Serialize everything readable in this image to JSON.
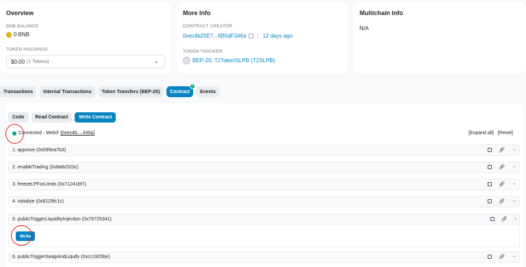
{
  "overview": {
    "title": "Overview",
    "balance_label": "BNB BALANCE",
    "balance_value": "0 BNB",
    "holdings_label": "TOKEN HOLDINGS",
    "holdings_value": "$0.00",
    "holdings_count": "(1 Tokens)"
  },
  "more_info": {
    "title": "More Info",
    "creator_label": "CONTRACT CREATOR",
    "creator_address": "0xec4b25E7...6B5dF346a",
    "creator_age": "12 days ago",
    "tracker_label": "TOKEN TRACKER",
    "tracker_value": "BEP-20: T2TokenSLPB (T2SLPB)"
  },
  "multichain": {
    "title": "Multichain Info",
    "value": "N/A"
  },
  "tabs": [
    "Transactions",
    "Internal Transactions",
    "Token Transfers (BEP-20)",
    "Contract",
    "Events"
  ],
  "active_tab": "Contract",
  "subtabs": [
    "Code",
    "Read Contract",
    "Write Contract"
  ],
  "active_subtab": "Write Contract",
  "connection": {
    "status": "Connected - Web3",
    "address": "[0xec4b....346a]",
    "expand_all": "[Expand all]",
    "reset": "[Reset]"
  },
  "functions": [
    {
      "label": "1. approve (0x095ea7b3)"
    },
    {
      "label": "2. enableTrading (0x8a8c523c)"
    },
    {
      "label": "3. freezeLPForLimits (0x71241bf7)"
    },
    {
      "label": "4. initialize (0x8129fc1c)"
    },
    {
      "label": "5. publicTriggerLiquidityInjection (0x78725341)"
    },
    {
      "label": "6. publicTriggerSwapAndLiquify (0xcc1925be)"
    }
  ],
  "write_button": "Write",
  "colors": {
    "accent": "#0784c3",
    "connected": "#00a186",
    "annotation": "#e02020"
  }
}
